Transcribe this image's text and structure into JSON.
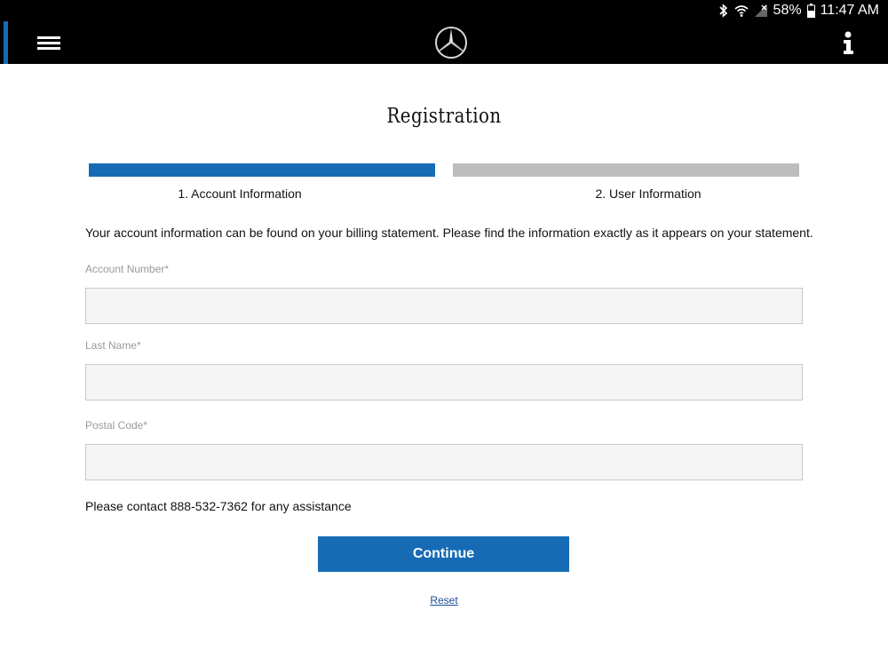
{
  "status_bar": {
    "battery": "58%",
    "time": "11:47 AM",
    "icons": [
      "bluetooth-icon",
      "wifi-icon",
      "no-signal-icon",
      "battery-icon"
    ]
  },
  "app_bar": {
    "menu_icon": "hamburger-menu-icon",
    "logo_icon": "three-pointed-star-logo",
    "info_icon": "info-icon"
  },
  "page": {
    "title": "Registration"
  },
  "steps": [
    {
      "label": "1. Account Information",
      "active": true
    },
    {
      "label": "2. User Information",
      "active": false
    }
  ],
  "form": {
    "intro": "Your account information can be found on your billing statement. Please find the information exactly as it appears on your statement.",
    "fields": [
      {
        "label": "Account Number*",
        "value": ""
      },
      {
        "label": "Last Name*",
        "value": ""
      },
      {
        "label": "Postal Code*",
        "value": ""
      }
    ],
    "help": "Please contact 888-532-7362 for any assistance",
    "continue_label": "Continue",
    "reset_label": "Reset"
  },
  "colors": {
    "accent": "#176bb5",
    "inactive_step": "#bdbdbd",
    "app_bar": "#000000",
    "link": "#1a4f94"
  }
}
